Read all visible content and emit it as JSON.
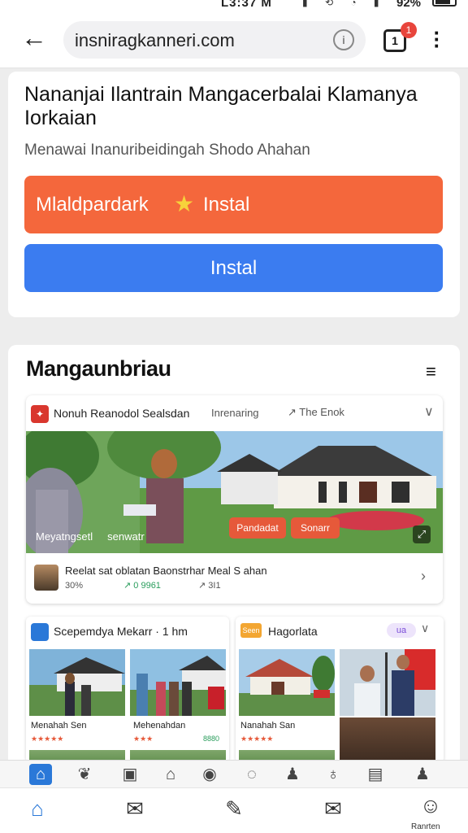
{
  "status_bar": {
    "time": "L3:37 M",
    "battery": "92%"
  },
  "browser": {
    "url": "insniragkanneri.com",
    "tab_count": "1",
    "notification_badge": "1"
  },
  "listing": {
    "title": "Nananjai Ilantrain Mangacerbalai Klamanya Iorkaian",
    "subtitle": "Menawai Inanuribeidingah Shodo Ahahan",
    "install_primary": {
      "label_left": "Mlaldpardark",
      "label_right": "Instal"
    },
    "install_secondary": "Instal"
  },
  "section": {
    "title": "Mangaunbriau",
    "featured_post": {
      "source": "Nonuh Reanodol Sealsdan",
      "type": "Inrenaring",
      "link": "The Enok",
      "image_caption": "Meyatngsetl",
      "image_caption_2": "senwatr",
      "pill_a": "Pandadat",
      "pill_b": "Sonarr",
      "footer_text": "Reelat sat oblatan Baonstrhar Meal S ahan",
      "stat_1": "30%",
      "stat_2": "0 9961",
      "stat_3": "3I1"
    },
    "grid_card_1": {
      "title": "Scepemdya Mekarr",
      "meta": "1 hm",
      "items": [
        {
          "label": "Menahah Sen",
          "meta": "★★★★★",
          "score": ""
        },
        {
          "label": "Mehenahdan",
          "meta": "★★★",
          "score": "8880"
        }
      ]
    },
    "grid_card_2": {
      "title": "Hagorlata",
      "badge": "Seen",
      "tag": "ua",
      "items": [
        {
          "label": "Nanahah San",
          "meta": "★★★★★",
          "score": ""
        }
      ]
    }
  },
  "app_tabs": [
    "home",
    "leaf",
    "tag",
    "bell",
    "pin",
    "chat",
    "person",
    "mask",
    "chip",
    "user"
  ],
  "bottom_nav": {
    "profile_label": "Ranrten"
  },
  "colors": {
    "orange": "#f4673c",
    "blue": "#3b7cf0",
    "accent": "#2a78d8"
  }
}
